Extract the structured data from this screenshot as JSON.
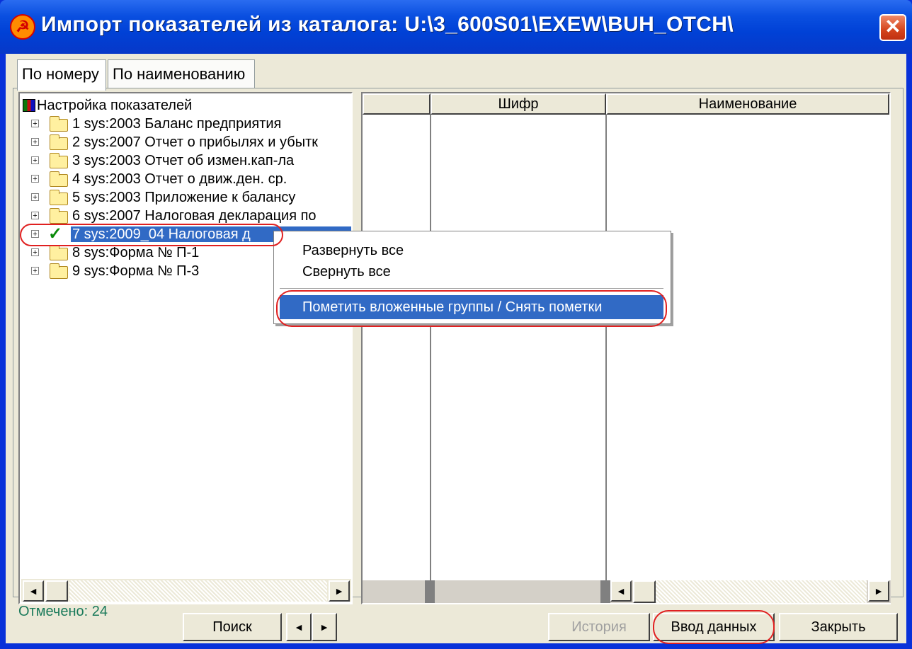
{
  "window": {
    "title": "Импорт показателей из каталога:  U:\\3_600S01\\EXEW\\BUH_OTCH\\",
    "close_glyph": "✕"
  },
  "tabs": [
    {
      "label": "По номеру",
      "active": true
    },
    {
      "label": "По наименованию",
      "active": false
    }
  ],
  "tree": {
    "root_label": "Настройка показателей",
    "items": [
      {
        "label": "1  sys:2003 Баланс предприятия",
        "checked": false,
        "selected": false
      },
      {
        "label": "2  sys:2007 Отчет о прибылях и убытк",
        "checked": false,
        "selected": false
      },
      {
        "label": "3  sys:2003 Отчет об измен.кап-ла",
        "checked": false,
        "selected": false
      },
      {
        "label": "4  sys:2003 Отчет о движ.ден. ср.",
        "checked": false,
        "selected": false
      },
      {
        "label": "5  sys:2003 Приложение к балансу",
        "checked": false,
        "selected": false
      },
      {
        "label": "6  sys:2007 Налоговая декларация по",
        "checked": false,
        "selected": false
      },
      {
        "label": "7  sys:2009_04 Налоговая д",
        "checked": true,
        "selected": true
      },
      {
        "label": "8  sys:Форма № П-1",
        "checked": false,
        "selected": false
      },
      {
        "label": "9  sys:Форма № П-3",
        "checked": false,
        "selected": false
      }
    ]
  },
  "grid": {
    "columns": [
      "",
      "Шифр",
      "Наименование"
    ]
  },
  "context_menu": {
    "items": [
      {
        "label": "Развернуть все",
        "highlighted": false
      },
      {
        "label": "Свернуть все",
        "highlighted": false
      },
      {
        "label": "Пометить вложенные группы / Снять пометки",
        "highlighted": true
      }
    ]
  },
  "footer": {
    "status": "Отмечено: 24",
    "search_label": "Поиск",
    "prev_glyph": "◄",
    "next_glyph": "►",
    "history_label": "История",
    "input_data_label": "Ввод данных",
    "close_label": "Закрыть"
  },
  "colors": {
    "title_bar": "#0a4fe0",
    "selection": "#316ac5",
    "annotation": "#e02020",
    "status_text": "#1a7a5a"
  }
}
